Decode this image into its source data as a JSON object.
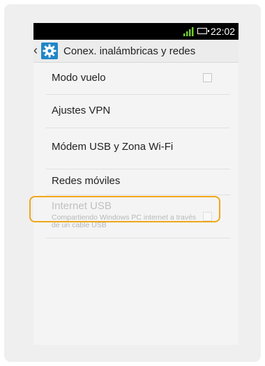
{
  "status_bar": {
    "time": "22:02",
    "signal_icon": "signal-icon",
    "battery_icon": "battery-icon"
  },
  "action_bar": {
    "back_icon": "back-chevron-icon",
    "app_icon": "settings-gear-icon",
    "title": "Conex. inalámbricas y redes"
  },
  "settings": [
    {
      "label": "Modo vuelo",
      "checked": false,
      "enabled": true
    },
    {
      "label": "Ajustes VPN",
      "enabled": true
    },
    {
      "label": "Módem USB y Zona Wi-Fi",
      "enabled": true
    },
    {
      "label": "Redes móviles",
      "enabled": true,
      "highlighted": true
    },
    {
      "label": "Internet USB",
      "summary": "Compartiendo Windows PC internet a través de un cable USB",
      "checked": false,
      "enabled": false
    }
  ],
  "colors": {
    "highlight": "#f0a61a",
    "app_icon_bg": "#1f86c8",
    "status_bar_bg": "#000000"
  }
}
